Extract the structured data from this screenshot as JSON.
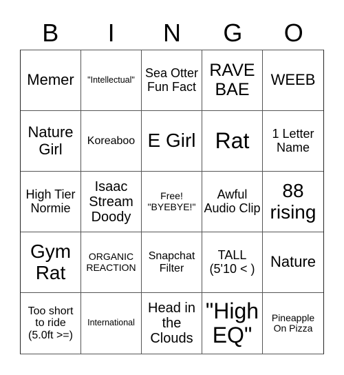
{
  "header": [
    "B",
    "I",
    "N",
    "G",
    "O"
  ],
  "cells": [
    "Memer",
    "\"Intellectual\"",
    "Sea Otter Fun Fact",
    "RAVE BAE",
    "WEEB",
    "Nature Girl",
    "Koreaboo",
    "E Girl",
    "Rat",
    "1 Letter Name",
    "High Tier Normie",
    "Isaac Stream Doody",
    "Free! \"BYEBYE!\"",
    "Awful Audio Clip",
    "88 rising",
    "Gym Rat",
    "ORGANIC REACTION",
    "Snapchat Filter",
    "TALL (5'10 < )",
    "Nature",
    "Too short to ride (5.0ft >=)",
    "International",
    "Head in the Clouds",
    "\"High EQ\"",
    "Pineapple On Pizza"
  ]
}
